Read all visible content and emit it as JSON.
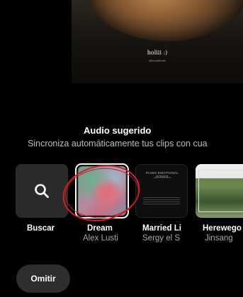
{
  "video": {
    "caption": "holiii :)",
    "subcaption": "@loudybeats"
  },
  "panel": {
    "title": "Audio sugerido",
    "subtitle": "Sincroniza automáticamente tus clips con cua"
  },
  "tiles": [
    {
      "label": "Buscar",
      "sub": ""
    },
    {
      "label": "Dream",
      "sub": "Alex Lusti"
    },
    {
      "label": "Married Li",
      "sub": "Sergy el S"
    },
    {
      "label": "Herewego",
      "sub": "Jinsang"
    }
  ],
  "album_art": {
    "married_title": "PIANO EMOTIONAL SONGS",
    "married_tiny": "piano instrumental"
  },
  "skip_label": "Omitir",
  "colors": {
    "background": "#000000",
    "tile_bg": "#2b2b2b",
    "annotation": "#d21e2e"
  }
}
